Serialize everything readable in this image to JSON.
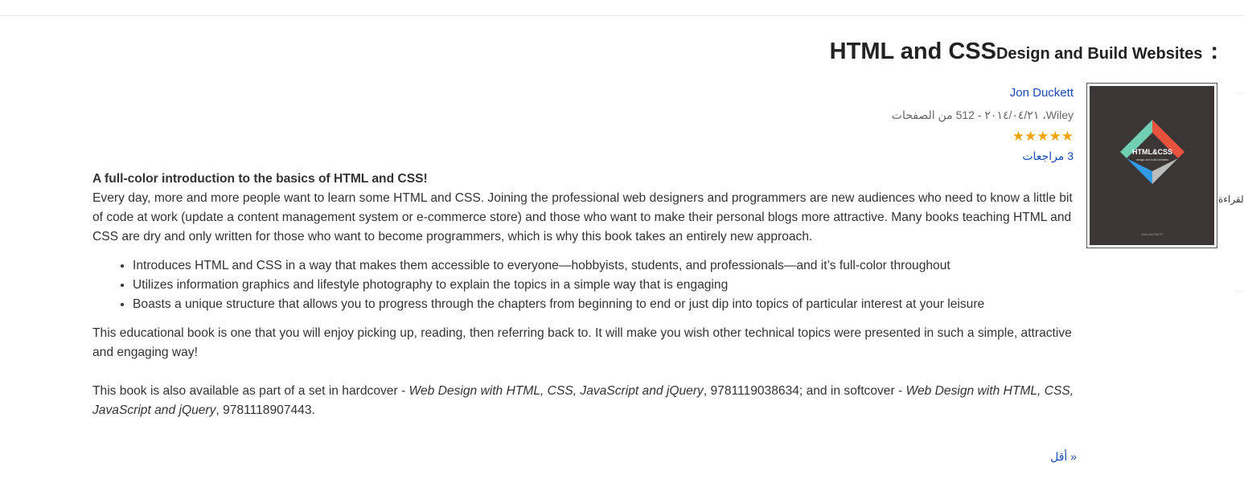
{
  "book": {
    "title_main": ":HTML and CSS",
    "title_sub": "Design and Build Websites",
    "author": "Jon Duckett",
    "publisher_line": "Wiley، ٢٠١٤/٠٤/٢١ - 512 من الصفحات",
    "stars": "★★★★★",
    "rating": 5,
    "reviews": "3 مراجعات",
    "cover": {
      "title": "HTML&CSS",
      "subtitle": "design and build websites",
      "author": "JON DUCKETT"
    }
  },
  "side_tab": "القراءة",
  "description": {
    "lead": "A full-color introduction to the basics of HTML and CSS!",
    "intro": "Every day, more and more people want to learn some HTML and CSS. Joining the professional web designers and programmers are new audiences who need to know a little bit of code at work (update a content management system or e-commerce store) and those who want to make their personal blogs more attractive. Many books teaching HTML and CSS are dry and only written for those who want to become programmers, which is why this book takes an entirely new approach.",
    "bullets": [
      "Introduces HTML and CSS in a way that makes them accessible to everyone—hobbyists, students, and professionals—and it’s full-color throughout",
      "Utilizes information graphics and lifestyle photography to explain the topics in a simple way that is engaging",
      "Boasts a unique structure that allows you to progress through the chapters from beginning to end or just dip into topics of particular interest at your leisure"
    ],
    "closing": "This educational book is one that you will enjoy picking up, reading, then referring back to. It will make you wish other technical topics were presented in such a simple, attractive and engaging way!",
    "set_prefix": "This book is also available as part of a set in hardcover - ",
    "set_title_1": "Web Design with HTML, CSS, JavaScript and jQuery",
    "set_mid": ", 9781119038634; and in softcover - ",
    "set_title_2": "Web Design with HTML, CSS, JavaScript and jQuery",
    "set_suffix": ", 9781118907443."
  },
  "less_link": "« أقل",
  "colors": {
    "link": "#1a4ab8",
    "star": "#f0a30a",
    "cover_bg": "#3b3535"
  }
}
